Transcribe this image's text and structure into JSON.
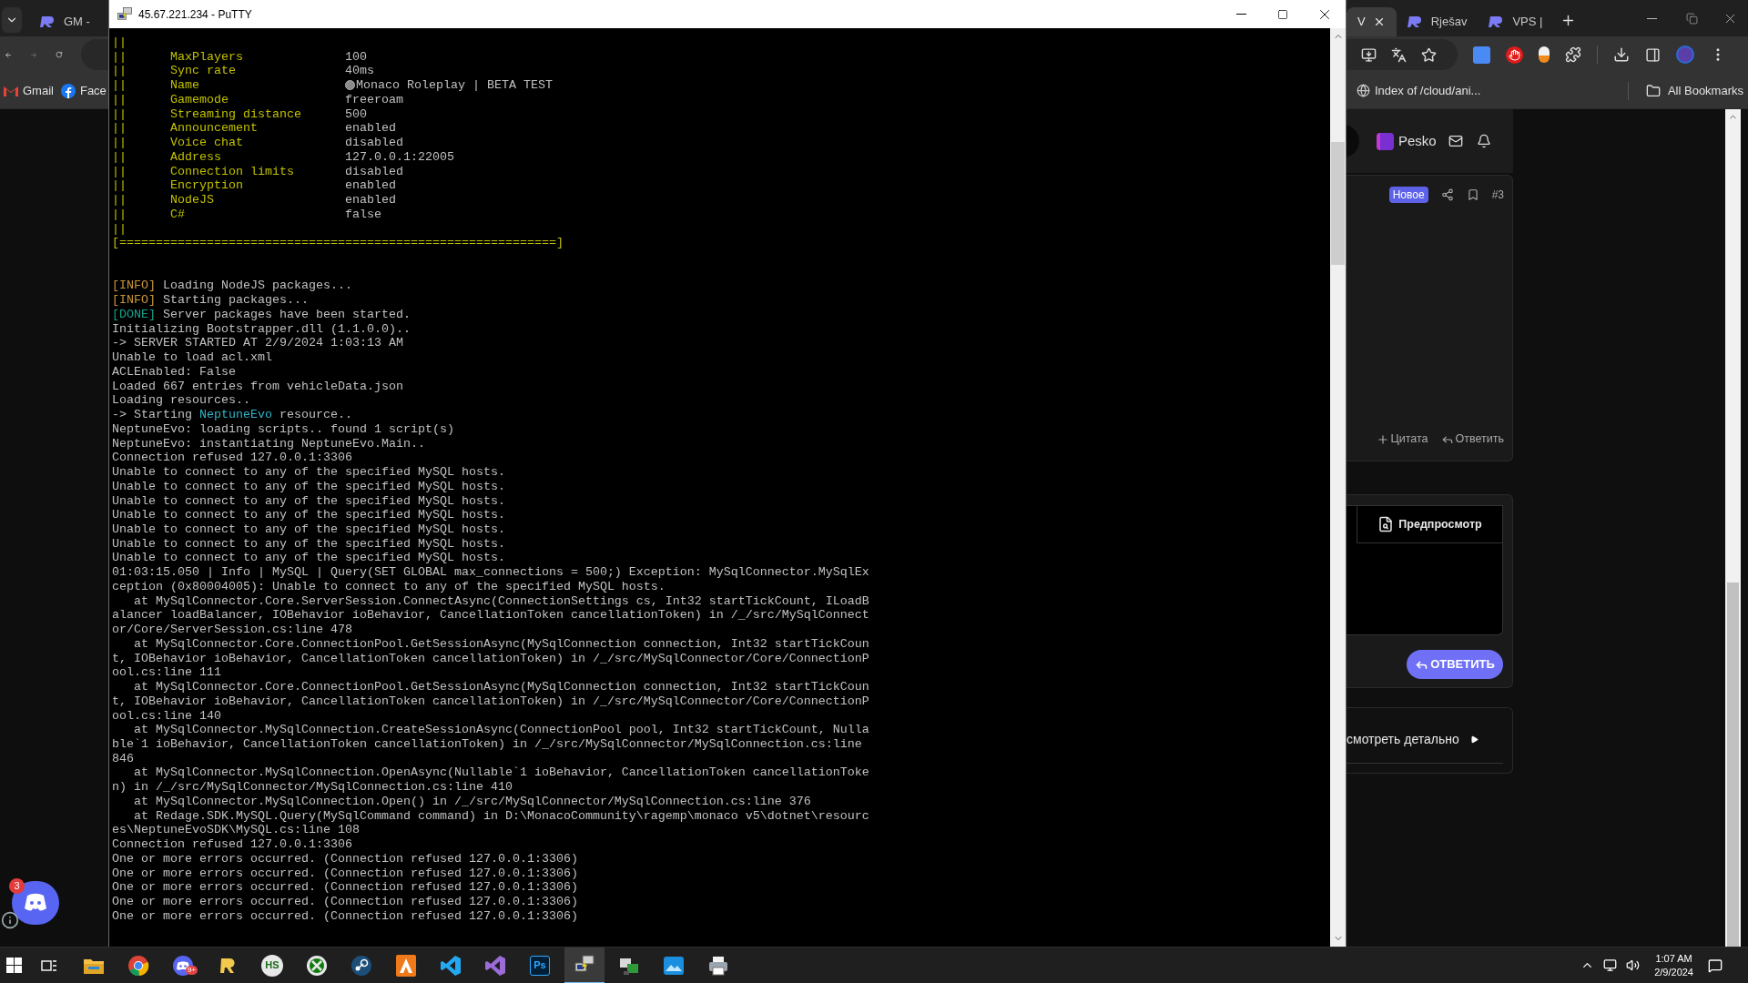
{
  "browser": {
    "tabs": [
      {
        "title": "GM -",
        "selected": false,
        "favicon": true
      },
      {
        "title": "V",
        "selected": true,
        "favicon": false
      },
      {
        "title": "Rješav",
        "selected": false,
        "favicon": true
      },
      {
        "title": "VPS |",
        "selected": false,
        "favicon": true
      }
    ],
    "bookmarks": [
      {
        "label": "Gmail",
        "kind": "gmail"
      },
      {
        "label": "Face",
        "kind": "facebook"
      },
      {
        "label": "Index of /cloud/ani...",
        "kind": "globe"
      }
    ],
    "all_bookmarks": "All Bookmarks",
    "forum": {
      "user": "Pesko",
      "badge": "Новое",
      "post_number": "#3",
      "quote": "Цитата",
      "reply_link": "Ответить",
      "preview": "Предпросмотр",
      "reply_button": "ОТВЕТИТЬ",
      "details_link": "смотреть детально"
    }
  },
  "putty": {
    "title": "45.67.221.234 - PuTTY",
    "lines": [
      {
        "kind": "frame",
        "text": "||"
      },
      {
        "kind": "setting",
        "frame": "||",
        "key": "MaxPlayers",
        "value": "100",
        "icon": false
      },
      {
        "kind": "setting",
        "frame": "||",
        "key": "Sync rate",
        "value": "40ms",
        "icon": false
      },
      {
        "kind": "setting",
        "frame": "||",
        "key": "Name",
        "value": "Monaco Roleplay | BETA TEST",
        "icon": true
      },
      {
        "kind": "setting",
        "frame": "||",
        "key": "Gamemode",
        "value": "freeroam",
        "icon": false
      },
      {
        "kind": "setting",
        "frame": "||",
        "key": "Streaming distance",
        "value": "500",
        "icon": false
      },
      {
        "kind": "setting",
        "frame": "||",
        "key": "Announcement",
        "value": "enabled",
        "icon": false
      },
      {
        "kind": "setting",
        "frame": "||",
        "key": "Voice chat",
        "value": "disabled",
        "icon": false
      },
      {
        "kind": "setting",
        "frame": "||",
        "key": "Address",
        "value": "127.0.0.1:22005",
        "icon": false
      },
      {
        "kind": "setting",
        "frame": "||",
        "key": "Connection limits",
        "value": "disabled",
        "icon": false
      },
      {
        "kind": "setting",
        "frame": "||",
        "key": "Encryption",
        "value": "enabled",
        "icon": false
      },
      {
        "kind": "setting",
        "frame": "||",
        "key": "NodeJS",
        "value": "enabled",
        "icon": false
      },
      {
        "kind": "setting",
        "frame": "||",
        "key": "C#",
        "value": "false",
        "icon": false
      },
      {
        "kind": "frame",
        "text": "||"
      },
      {
        "kind": "frame",
        "text": "[============================================================]"
      },
      {
        "kind": "blank"
      },
      {
        "kind": "blank"
      },
      {
        "kind": "text",
        "segments": [
          {
            "text": "[INFO]",
            "kind": "info"
          },
          {
            "text": " Loading NodeJS packages...",
            "kind": "plain"
          }
        ]
      },
      {
        "kind": "text",
        "segments": [
          {
            "text": "[INFO]",
            "kind": "info"
          },
          {
            "text": " Starting packages...",
            "kind": "plain"
          }
        ]
      },
      {
        "kind": "text",
        "segments": [
          {
            "text": "[DONE]",
            "kind": "done"
          },
          {
            "text": " Server packages have been started.",
            "kind": "plain"
          }
        ]
      },
      {
        "kind": "text",
        "segments": [
          {
            "text": "Initializing Bootstrapper.dll (1.1.0.0)..",
            "kind": "plain"
          }
        ]
      },
      {
        "kind": "text",
        "segments": [
          {
            "text": "-> SERVER STARTED AT 2/9/2024 1:03:13 AM",
            "kind": "plain"
          }
        ]
      },
      {
        "kind": "text",
        "segments": [
          {
            "text": "Unable to load acl.xml",
            "kind": "plain"
          }
        ]
      },
      {
        "kind": "text",
        "segments": [
          {
            "text": "ACLEnabled: False",
            "kind": "plain"
          }
        ]
      },
      {
        "kind": "text",
        "segments": [
          {
            "text": "Loaded 667 entries from vehicleData.json",
            "kind": "plain"
          }
        ]
      },
      {
        "kind": "text",
        "segments": [
          {
            "text": "Loading resources..",
            "kind": "plain"
          }
        ]
      },
      {
        "kind": "text",
        "segments": [
          {
            "text": "-> Starting ",
            "kind": "plain"
          },
          {
            "text": "NeptuneEvo",
            "kind": "name"
          },
          {
            "text": " resource..",
            "kind": "plain"
          }
        ]
      },
      {
        "kind": "text",
        "segments": [
          {
            "text": "NeptuneEvo: loading scripts.. found 1 script(s)",
            "kind": "plain"
          }
        ]
      },
      {
        "kind": "text",
        "segments": [
          {
            "text": "NeptuneEvo: instantiating NeptuneEvo.Main..",
            "kind": "plain"
          }
        ]
      },
      {
        "kind": "text",
        "segments": [
          {
            "text": "Connection refused 127.0.0.1:3306",
            "kind": "plain"
          }
        ]
      },
      {
        "kind": "text",
        "segments": [
          {
            "text": "Unable to connect to any of the specified MySQL hosts.",
            "kind": "plain"
          }
        ]
      },
      {
        "kind": "text",
        "segments": [
          {
            "text": "Unable to connect to any of the specified MySQL hosts.",
            "kind": "plain"
          }
        ]
      },
      {
        "kind": "text",
        "segments": [
          {
            "text": "Unable to connect to any of the specified MySQL hosts.",
            "kind": "plain"
          }
        ]
      },
      {
        "kind": "text",
        "segments": [
          {
            "text": "Unable to connect to any of the specified MySQL hosts.",
            "kind": "plain"
          }
        ]
      },
      {
        "kind": "text",
        "segments": [
          {
            "text": "Unable to connect to any of the specified MySQL hosts.",
            "kind": "plain"
          }
        ]
      },
      {
        "kind": "text",
        "segments": [
          {
            "text": "Unable to connect to any of the specified MySQL hosts.",
            "kind": "plain"
          }
        ]
      },
      {
        "kind": "text",
        "segments": [
          {
            "text": "Unable to connect to any of the specified MySQL hosts.",
            "kind": "plain"
          }
        ]
      },
      {
        "kind": "text",
        "segments": [
          {
            "text": "01:03:15.050 | Info | MySQL | Query(SET GLOBAL max_connections = 500;) Exception: MySqlConnector.MySqlEx",
            "kind": "plain"
          }
        ]
      },
      {
        "kind": "text",
        "segments": [
          {
            "text": "ception (0x80004005): Unable to connect to any of the specified MySQL hosts.",
            "kind": "plain"
          }
        ]
      },
      {
        "kind": "text",
        "segments": [
          {
            "text": "   at MySqlConnector.Core.ServerSession.ConnectAsync(ConnectionSettings cs, Int32 startTickCount, ILoadB",
            "kind": "plain"
          }
        ]
      },
      {
        "kind": "text",
        "segments": [
          {
            "text": "alancer loadBalancer, IOBehavior ioBehavior, CancellationToken cancellationToken) in /_/src/MySqlConnect",
            "kind": "plain"
          }
        ]
      },
      {
        "kind": "text",
        "segments": [
          {
            "text": "or/Core/ServerSession.cs:line 478",
            "kind": "plain"
          }
        ]
      },
      {
        "kind": "text",
        "segments": [
          {
            "text": "   at MySqlConnector.Core.ConnectionPool.GetSessionAsync(MySqlConnection connection, Int32 startTickCoun",
            "kind": "plain"
          }
        ]
      },
      {
        "kind": "text",
        "segments": [
          {
            "text": "t, IOBehavior ioBehavior, CancellationToken cancellationToken) in /_/src/MySqlConnector/Core/ConnectionP",
            "kind": "plain"
          }
        ]
      },
      {
        "kind": "text",
        "segments": [
          {
            "text": "ool.cs:line 111",
            "kind": "plain"
          }
        ]
      },
      {
        "kind": "text",
        "segments": [
          {
            "text": "   at MySqlConnector.Core.ConnectionPool.GetSessionAsync(MySqlConnection connection, Int32 startTickCoun",
            "kind": "plain"
          }
        ]
      },
      {
        "kind": "text",
        "segments": [
          {
            "text": "t, IOBehavior ioBehavior, CancellationToken cancellationToken) in /_/src/MySqlConnector/Core/ConnectionP",
            "kind": "plain"
          }
        ]
      },
      {
        "kind": "text",
        "segments": [
          {
            "text": "ool.cs:line 140",
            "kind": "plain"
          }
        ]
      },
      {
        "kind": "text",
        "segments": [
          {
            "text": "   at MySqlConnector.MySqlConnection.CreateSessionAsync(ConnectionPool pool, Int32 startTickCount, Nulla",
            "kind": "plain"
          }
        ]
      },
      {
        "kind": "text",
        "segments": [
          {
            "text": "ble`1 ioBehavior, CancellationToken cancellationToken) in /_/src/MySqlConnector/MySqlConnection.cs:line",
            "kind": "plain"
          }
        ]
      },
      {
        "kind": "text",
        "segments": [
          {
            "text": "846",
            "kind": "plain"
          }
        ]
      },
      {
        "kind": "text",
        "segments": [
          {
            "text": "   at MySqlConnector.MySqlConnection.OpenAsync(Nullable`1 ioBehavior, CancellationToken cancellationToke",
            "kind": "plain"
          }
        ]
      },
      {
        "kind": "text",
        "segments": [
          {
            "text": "n) in /_/src/MySqlConnector/MySqlConnection.cs:line 410",
            "kind": "plain"
          }
        ]
      },
      {
        "kind": "text",
        "segments": [
          {
            "text": "   at MySqlConnector.MySqlConnection.Open() in /_/src/MySqlConnector/MySqlConnection.cs:line 376",
            "kind": "plain"
          }
        ]
      },
      {
        "kind": "text",
        "segments": [
          {
            "text": "   at Redage.SDK.MySQL.Query(MySqlCommand command) in D:\\MonacoCommunity\\ragemp\\monaco v5\\dotnet\\resourc",
            "kind": "plain"
          }
        ]
      },
      {
        "kind": "text",
        "segments": [
          {
            "text": "es\\NeptuneEvoSDK\\MySQL.cs:line 108",
            "kind": "plain"
          }
        ]
      },
      {
        "kind": "text",
        "segments": [
          {
            "text": "Connection refused 127.0.0.1:3306",
            "kind": "plain"
          }
        ]
      },
      {
        "kind": "text",
        "segments": [
          {
            "text": "One or more errors occurred. (Connection refused 127.0.0.1:3306)",
            "kind": "plain"
          }
        ]
      },
      {
        "kind": "text",
        "segments": [
          {
            "text": "One or more errors occurred. (Connection refused 127.0.0.1:3306)",
            "kind": "plain"
          }
        ]
      },
      {
        "kind": "text",
        "segments": [
          {
            "text": "One or more errors occurred. (Connection refused 127.0.0.1:3306)",
            "kind": "plain"
          }
        ]
      },
      {
        "kind": "text",
        "segments": [
          {
            "text": "One or more errors occurred. (Connection refused 127.0.0.1:3306)",
            "kind": "plain"
          }
        ]
      },
      {
        "kind": "text",
        "segments": [
          {
            "text": "One or more errors occurred. (Connection refused 127.0.0.1:3306)",
            "kind": "plain"
          }
        ]
      }
    ]
  },
  "discord": {
    "badge": "3"
  },
  "taskbar": {
    "apps": [
      {
        "kind": "taskview",
        "selected": false
      },
      {
        "kind": "explorer",
        "selected": false
      },
      {
        "kind": "chrome",
        "selected": false
      },
      {
        "kind": "discord",
        "selected": false,
        "badge": "9+"
      },
      {
        "kind": "rlogo",
        "selected": false
      },
      {
        "kind": "hs",
        "selected": false,
        "label": "HS"
      },
      {
        "kind": "xbox",
        "selected": false
      },
      {
        "kind": "steam",
        "selected": false
      },
      {
        "kind": "orange",
        "selected": false
      },
      {
        "kind": "vscode",
        "selected": false
      },
      {
        "kind": "vs",
        "selected": false
      },
      {
        "kind": "ps",
        "selected": false,
        "label": "Ps"
      },
      {
        "kind": "putty",
        "selected": true
      },
      {
        "kind": "network",
        "selected": false
      },
      {
        "kind": "photos",
        "selected": false
      },
      {
        "kind": "printer",
        "selected": false
      }
    ],
    "time": "1:07 AM",
    "date": "2/9/2024"
  }
}
